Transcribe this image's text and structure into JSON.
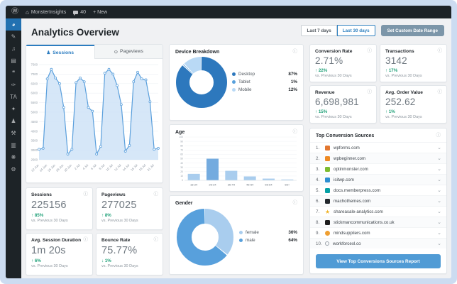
{
  "admin_bar": {
    "site_name": "MonsterInsights",
    "comments_count": "40",
    "new_label": "+ New"
  },
  "sidebar": {
    "items": [
      {
        "name": "dashboard",
        "glyph": "◕",
        "active": true
      },
      {
        "name": "posts",
        "glyph": "✎",
        "active": false
      },
      {
        "name": "media",
        "glyph": "♫",
        "active": false
      },
      {
        "name": "pages",
        "glyph": "▤",
        "active": false
      },
      {
        "name": "comments",
        "glyph": "❝",
        "active": false
      },
      {
        "name": "appearance",
        "glyph": "✑",
        "active": false
      },
      {
        "name": "analytics-ta",
        "glyph": "TA",
        "active": false
      },
      {
        "name": "plugins",
        "glyph": "✦",
        "active": false
      },
      {
        "name": "users",
        "glyph": "♟",
        "active": false
      },
      {
        "name": "tools",
        "glyph": "⚒",
        "active": false
      },
      {
        "name": "settings",
        "glyph": "▥",
        "active": false
      },
      {
        "name": "monsterinsights",
        "glyph": "❋",
        "active": false
      },
      {
        "name": "collapse-menu",
        "glyph": "⚙",
        "active": false
      }
    ]
  },
  "header": {
    "title": "Analytics Overview"
  },
  "date_buttons": {
    "last7": "Last 7 days",
    "last30": "Last 30 days",
    "custom": "Set Custom Date Range"
  },
  "tabs": {
    "sessions": "Sessions",
    "pageviews": "Pageviews"
  },
  "metrics": {
    "sessions": {
      "label": "Sessions",
      "value": "225156",
      "arrow": "↑",
      "change": "85%",
      "vs": "vs. Previous 30 Days"
    },
    "pageviews": {
      "label": "Pageviews",
      "value": "277025",
      "arrow": "↑",
      "change": "8%",
      "vs": "vs. Previous 30 Days"
    },
    "avg_session": {
      "label": "Avg. Session Duration",
      "value": "1m 20s",
      "arrow": "↑",
      "change": "6%",
      "vs": "vs. Previous 30 Days"
    },
    "bounce_rate": {
      "label": "Bounce Rate",
      "value": "75.77%",
      "arrow": "↓",
      "change": "1%",
      "vs": "vs. Previous 30 Days"
    },
    "conversion_rate": {
      "label": "Conversion Rate",
      "value": "2.71%",
      "arrow": "↑",
      "change": "22%",
      "vs": "vs. Previous 30 Days"
    },
    "transactions": {
      "label": "Transactions",
      "value": "3142",
      "arrow": "↑",
      "change": "17%",
      "vs": "vs. Previous 30 Days"
    },
    "revenue": {
      "label": "Revenue",
      "value": "6,698,981",
      "arrow": "↑",
      "change": "15%",
      "vs": "vs. Previous 30 Days"
    },
    "avg_order_value": {
      "label": "Avg. Order Value",
      "value": "252.62",
      "arrow": "↑",
      "change": "1%",
      "vs": "vs. Previous 30 Days"
    }
  },
  "cards": {
    "device": "Device Breakdown",
    "age": "Age",
    "gender": "Gender"
  },
  "top_sources": {
    "title": "Top Conversion Sources",
    "button": "View Top Conversions Sources Report",
    "items": [
      {
        "rank": "1.",
        "domain": "wpforms.com",
        "icon": "square",
        "color": "#e27730"
      },
      {
        "rank": "2.",
        "domain": "wpbeginner.com",
        "icon": "square",
        "color": "#ee8922"
      },
      {
        "rank": "3.",
        "domain": "optinmonster.com",
        "icon": "square",
        "color": "#7ebc2f"
      },
      {
        "rank": "4.",
        "domain": "isitwp.com",
        "icon": "square",
        "color": "#2c8ed1"
      },
      {
        "rank": "5.",
        "domain": "docs.memberpress.com",
        "icon": "square",
        "color": "#05a0a5"
      },
      {
        "rank": "6.",
        "domain": "machothemes.com",
        "icon": "square",
        "color": "#23282d"
      },
      {
        "rank": "7.",
        "domain": "shareasale-analytics.com",
        "icon": "star",
        "color": "#f0b429"
      },
      {
        "rank": "8.",
        "domain": "stickmancommunications.co.uk",
        "icon": "square",
        "color": "#1d1d1d"
      },
      {
        "rank": "9.",
        "domain": "mindsuppliers.com",
        "icon": "circle",
        "color": "#ef9f31"
      },
      {
        "rank": "10.",
        "domain": "workforcexl.co",
        "icon": "globe",
        "color": "#98a0a8"
      }
    ]
  },
  "chart_data": [
    {
      "id": "sessions-over-time",
      "type": "area",
      "title": "Sessions",
      "x_labels": [
        "22 Jun",
        "24 Jun",
        "26 Jun",
        "28 Jun",
        "30 Jun",
        "2 Jul",
        "4 Jul",
        "6 Jul",
        "8 Jul",
        "10 Jul",
        "12 Jul",
        "14 Jul",
        "16 Jul",
        "18 Jul",
        "21 Jul"
      ],
      "values": [
        3050,
        3100,
        6750,
        7250,
        6800,
        6500,
        5250,
        2800,
        3050,
        6550,
        6800,
        6600,
        5250,
        5050,
        2800,
        3200,
        7050,
        7250,
        7000,
        6400,
        5400,
        2950,
        3250,
        6600,
        7100,
        6750,
        6700,
        5550,
        3050,
        3100
      ],
      "ylim": [
        2500,
        7500
      ],
      "ytick_step": 500,
      "line_color": "#5a9fdc",
      "fill_color": "#cfe3f7"
    },
    {
      "id": "device-breakdown",
      "type": "pie",
      "title": "Device Breakdown",
      "labels": [
        "Desktop",
        "Tablet",
        "Mobile"
      ],
      "values": [
        87,
        1,
        12
      ],
      "display": [
        "87%",
        "1%",
        "12%"
      ],
      "colors": [
        "#2d78bd",
        "#58a0dc",
        "#b9d9f5"
      ]
    },
    {
      "id": "age",
      "type": "bar",
      "title": "Age",
      "categories": [
        "18-24",
        "25-34",
        "35-44",
        "45-54",
        "55-64",
        "65+"
      ],
      "values": [
        15,
        50,
        22,
        9,
        4,
        2
      ],
      "ylim": [
        0,
        100
      ],
      "ytick_step": 10,
      "bar_colors": [
        "#a9cdee",
        "#74abdf",
        "#a9cdee",
        "#a9cdee",
        "#a9cdee",
        "#a9cdee"
      ]
    },
    {
      "id": "gender",
      "type": "pie",
      "title": "Gender",
      "labels": [
        "female",
        "male"
      ],
      "values": [
        36,
        64
      ],
      "display": [
        "36%",
        "64%"
      ],
      "colors": [
        "#a9cdee",
        "#58a0dc"
      ]
    }
  ]
}
